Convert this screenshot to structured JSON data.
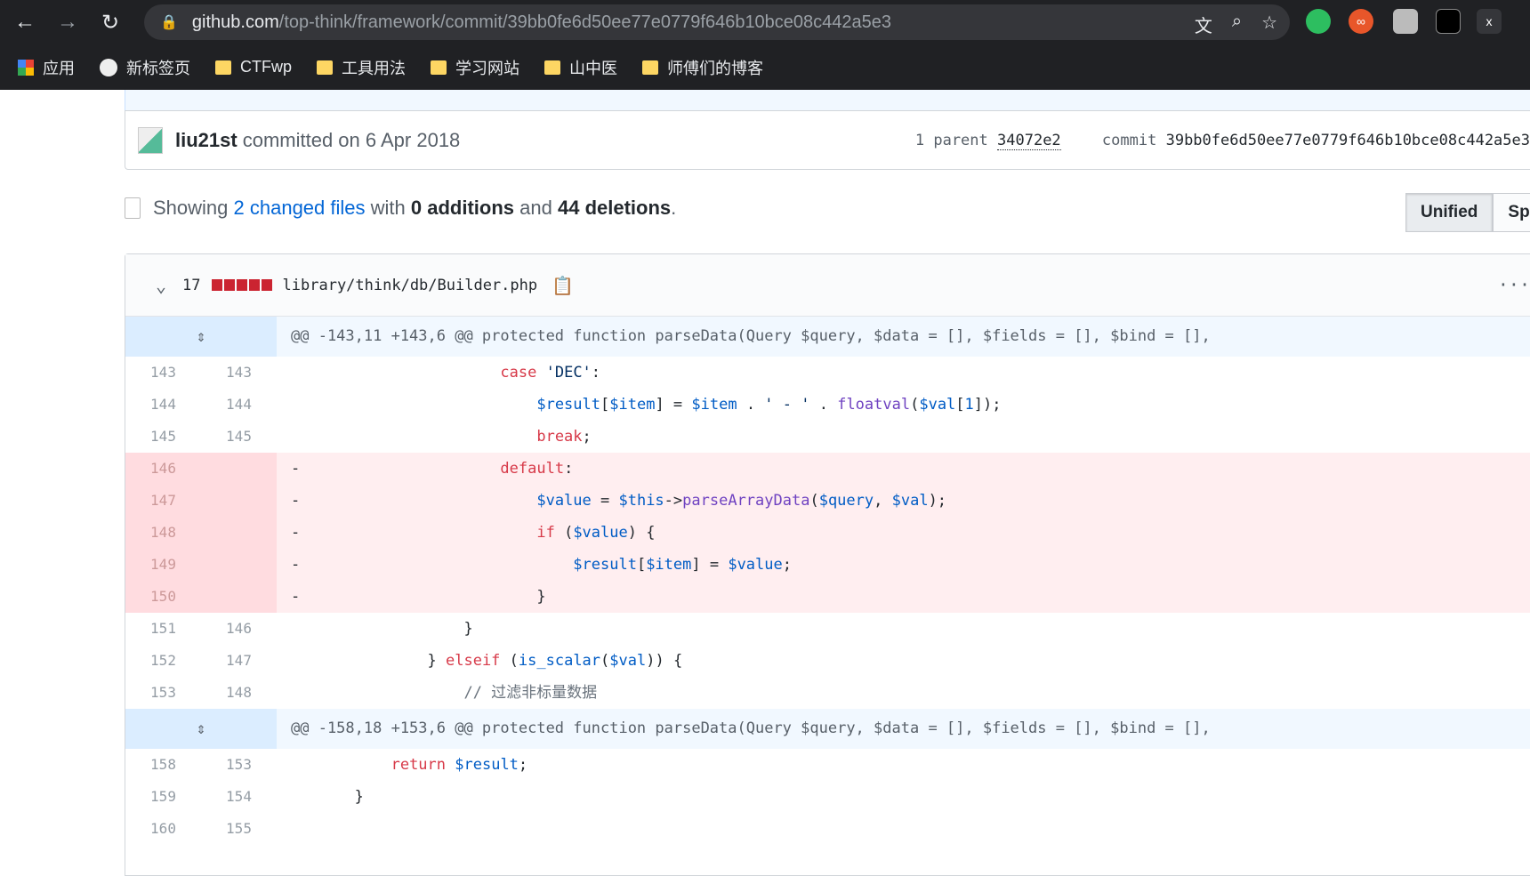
{
  "browser": {
    "url_host": "github.com",
    "url_path": "/top-think/framework/commit/39bb0fe6d50ee77e0779f646b10bce08c442a5e3"
  },
  "bookmarks": [
    {
      "label": "应用",
      "icon": "apps-grid"
    },
    {
      "label": "新标签页",
      "icon": "globe"
    },
    {
      "label": "CTFwp",
      "icon": "folder"
    },
    {
      "label": "工具用法",
      "icon": "folder"
    },
    {
      "label": "学习网站",
      "icon": "folder"
    },
    {
      "label": "山中医",
      "icon": "folder"
    },
    {
      "label": "师傅们的博客",
      "icon": "folder"
    }
  ],
  "commit": {
    "author": "liu21st",
    "committed": "committed on 6 Apr 2018",
    "parent_label": "1 parent",
    "parent_sha": "34072e2",
    "commit_label": "commit",
    "sha": "39bb0fe6d50ee77e0779f646b10bce08c442a5e3"
  },
  "summary": {
    "showing": "Showing",
    "changed": "2 changed files",
    "with": "with",
    "additions": "0 additions",
    "and": "and",
    "deletions": "44 deletions",
    "end": "."
  },
  "view": {
    "unified": "Unified",
    "split": "Split"
  },
  "file": {
    "count": "17",
    "path": "library/think/db/Builder.php",
    "colors": {
      "deletion": "#cb2431"
    }
  },
  "rows": [
    {
      "type": "hunk",
      "text": "@@ -143,11 +143,6 @@ protected function parseData(Query $query, $data = [], $fields = [], $bind = [],"
    },
    {
      "type": "ctx",
      "old": "143",
      "new": "143",
      "seg": [
        [
          "                       ",
          ""
        ],
        [
          "case",
          "k"
        ],
        [
          " ",
          ""
        ],
        [
          "'DEC'",
          "s"
        ],
        [
          ":",
          ""
        ]
      ]
    },
    {
      "type": "ctx",
      "old": "144",
      "new": "144",
      "seg": [
        [
          "                           ",
          ""
        ],
        [
          "$result",
          "vr"
        ],
        [
          "[",
          ""
        ],
        [
          "$item",
          "vr"
        ],
        [
          "] = ",
          ""
        ],
        [
          "$item",
          "vr"
        ],
        [
          " . ",
          ""
        ],
        [
          "' - '",
          "s"
        ],
        [
          " . ",
          ""
        ],
        [
          "floatval",
          "f"
        ],
        [
          "(",
          ""
        ],
        [
          "$val",
          "vr"
        ],
        [
          "[",
          ""
        ],
        [
          "1",
          "vr"
        ],
        [
          "]);",
          ""
        ]
      ]
    },
    {
      "type": "ctx",
      "old": "145",
      "new": "145",
      "seg": [
        [
          "                           ",
          ""
        ],
        [
          "break",
          "k"
        ],
        [
          ";",
          ""
        ]
      ]
    },
    {
      "type": "del",
      "old": "146",
      "new": "",
      "seg": [
        [
          "-                      ",
          ""
        ],
        [
          "default",
          "k"
        ],
        [
          ":",
          ""
        ]
      ]
    },
    {
      "type": "del",
      "old": "147",
      "new": "",
      "seg": [
        [
          "-                          ",
          ""
        ],
        [
          "$value",
          "vr"
        ],
        [
          " = ",
          ""
        ],
        [
          "$this",
          "vr"
        ],
        [
          "->",
          ""
        ],
        [
          "parseArrayData",
          "f"
        ],
        [
          "(",
          ""
        ],
        [
          "$query",
          "vr"
        ],
        [
          ", ",
          ""
        ],
        [
          "$val",
          "vr"
        ],
        [
          ");",
          ""
        ]
      ]
    },
    {
      "type": "del",
      "old": "148",
      "new": "",
      "seg": [
        [
          "-                          ",
          ""
        ],
        [
          "if",
          "k"
        ],
        [
          " (",
          ""
        ],
        [
          "$value",
          "vr"
        ],
        [
          ") {",
          ""
        ]
      ]
    },
    {
      "type": "del",
      "old": "149",
      "new": "",
      "seg": [
        [
          "-                              ",
          ""
        ],
        [
          "$result",
          "vr"
        ],
        [
          "[",
          ""
        ],
        [
          "$item",
          "vr"
        ],
        [
          "] = ",
          ""
        ],
        [
          "$value",
          "vr"
        ],
        [
          ";",
          ""
        ]
      ]
    },
    {
      "type": "del",
      "old": "150",
      "new": "",
      "seg": [
        [
          "-                          }",
          ""
        ]
      ]
    },
    {
      "type": "ctx",
      "old": "151",
      "new": "146",
      "seg": [
        [
          "                   }",
          ""
        ]
      ]
    },
    {
      "type": "ctx",
      "old": "152",
      "new": "147",
      "seg": [
        [
          "               } ",
          ""
        ],
        [
          "elseif",
          "k"
        ],
        [
          " (",
          ""
        ],
        [
          "is_scalar",
          "vr"
        ],
        [
          "(",
          ""
        ],
        [
          "$val",
          "vr"
        ],
        [
          ")) {",
          ""
        ]
      ]
    },
    {
      "type": "ctx",
      "old": "153",
      "new": "148",
      "seg": [
        [
          "                   ",
          ""
        ],
        [
          "// 过滤非标量数据",
          "c"
        ]
      ]
    },
    {
      "type": "hunk",
      "text": "@@ -158,18 +153,6 @@ protected function parseData(Query $query, $data = [], $fields = [], $bind = [],"
    },
    {
      "type": "ctx",
      "old": "158",
      "new": "153",
      "seg": [
        [
          "           ",
          ""
        ],
        [
          "return",
          "k"
        ],
        [
          " ",
          ""
        ],
        [
          "$result",
          "vr"
        ],
        [
          ";",
          ""
        ]
      ]
    },
    {
      "type": "ctx",
      "old": "159",
      "new": "154",
      "seg": [
        [
          "       }",
          ""
        ]
      ]
    },
    {
      "type": "ctx",
      "old": "160",
      "new": "155",
      "seg": [
        [
          "",
          ""
        ]
      ]
    }
  ]
}
